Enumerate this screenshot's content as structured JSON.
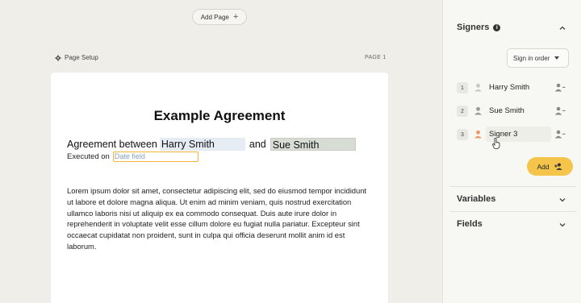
{
  "canvas": {
    "add_page_label": "Add Page",
    "page_setup_label": "Page Setup",
    "page_number": "PAGE 1"
  },
  "document": {
    "title": "Example Agreement",
    "agreement_prefix": "Agreement between",
    "signer1_field": "Harry Smith",
    "and_text": "and",
    "signer2_field": "Sue Smith",
    "executed_label": "Executed on",
    "date_placeholder": "Date field",
    "body": "Lorem ipsum dolor sit amet, consectetur adipiscing elit, sed do eiusmod tempor incididunt ut labore et dolore magna aliqua. Ut enim ad minim veniam, quis nostrud exercitation ullamco laboris nisi ut aliquip ex ea commodo consequat. Duis aute irure dolor in reprehenderit in voluptate velit esse cillum dolore eu fugiat nulla pariatur. Excepteur sint occaecat cupidatat non proident, sunt in culpa qui officia deserunt mollit anim id est laborum."
  },
  "panel": {
    "signers_title": "Signers",
    "order_select": "Sign in order",
    "signers": [
      {
        "number": "1",
        "name": "Harry Smith"
      },
      {
        "number": "2",
        "name": "Sue Smith"
      },
      {
        "number": "3",
        "name": "Signer 3"
      }
    ],
    "add_label": "Add",
    "variables_title": "Variables",
    "fields_title": "Fields"
  },
  "colors": {
    "accent": "#f4c54a",
    "date_border": "#f2b63c",
    "signer1_highlight": "#e6ecf3",
    "signer2_highlight": "#d7ddd5",
    "signer3_person": "#e79a6a"
  }
}
